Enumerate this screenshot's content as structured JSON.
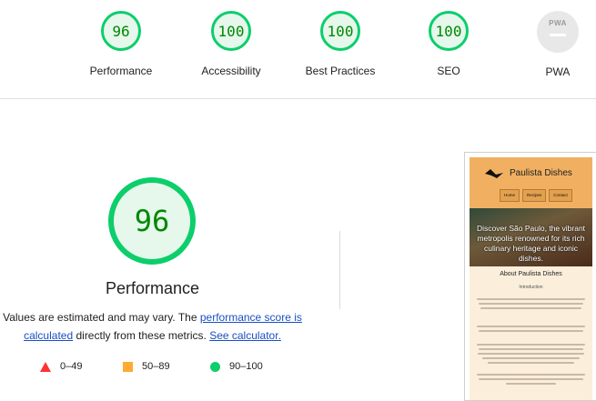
{
  "categories": [
    {
      "label": "Performance",
      "score": "96"
    },
    {
      "label": "Accessibility",
      "score": "100"
    },
    {
      "label": "Best Practices",
      "score": "100"
    },
    {
      "label": "SEO",
      "score": "100"
    }
  ],
  "pwa": {
    "label": "PWA",
    "badge_text": "PWA"
  },
  "main": {
    "score": "96",
    "title": "Performance",
    "desc_prefix": "Values are estimated and may vary. The ",
    "desc_link1": "performance score is calculated",
    "desc_middle": " directly from these metrics. ",
    "desc_link2": "See calculator."
  },
  "legend": [
    {
      "range": "0–49",
      "color": "#ff3333",
      "icon": "triangle-icon"
    },
    {
      "range": "50–89",
      "color": "#ffaa33",
      "icon": "square-icon"
    },
    {
      "range": "90–100",
      "color": "#0cce6b",
      "icon": "circle-icon"
    }
  ],
  "screenshot": {
    "brand": "Paulista Dishes",
    "nav": [
      "Home",
      "Recipes",
      "Contact"
    ],
    "hero_text": "Discover São Paulo, the vibrant metropolis renowned for its rich culinary heritage and iconic dishes.",
    "about_title": "About Paulista Dishes",
    "intro": "Introduction"
  },
  "colors": {
    "pass": "#0cce6b",
    "pass_text": "#008800",
    "link": "#1a4fc4"
  }
}
